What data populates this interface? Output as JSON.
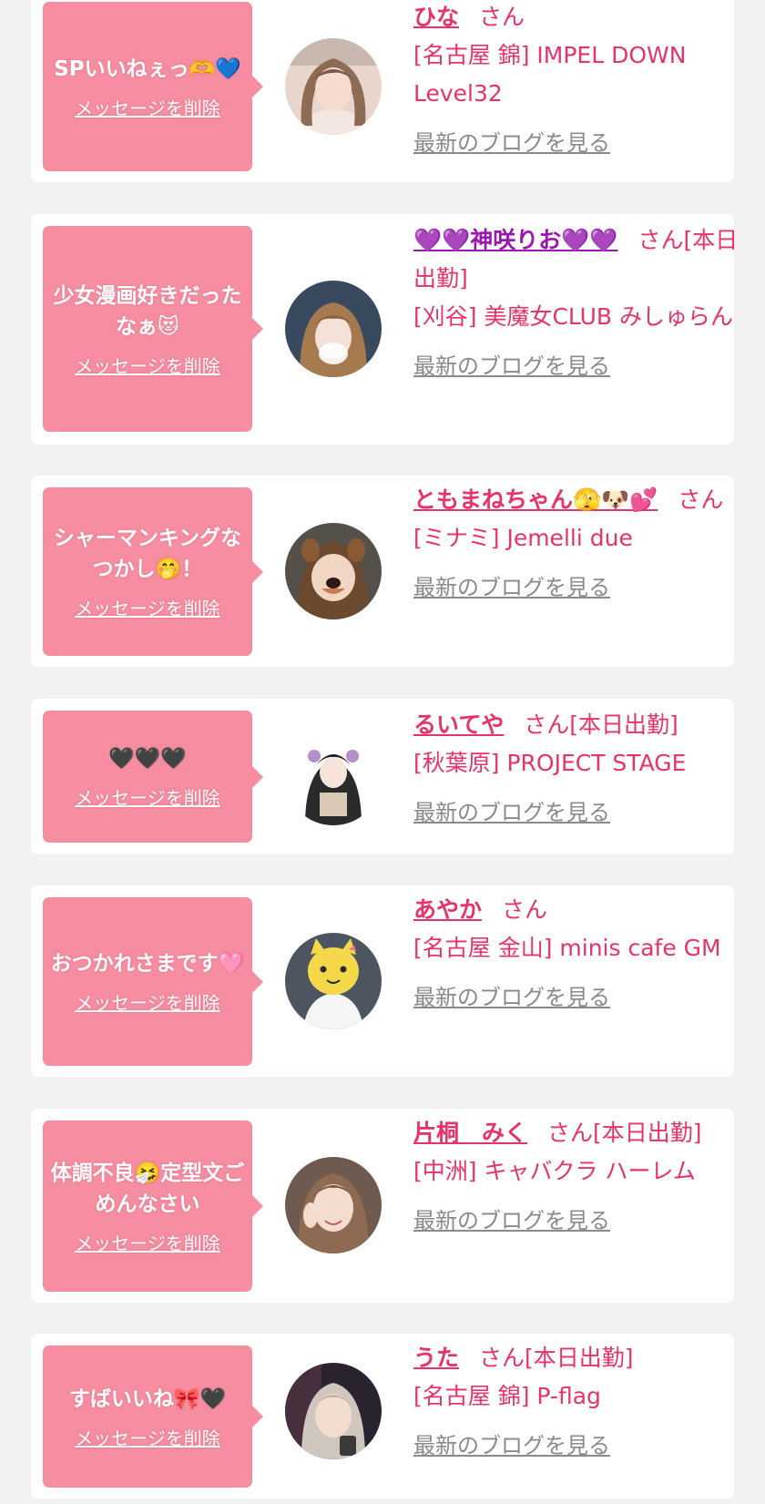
{
  "colors": {
    "page_background": "#f2f2f2",
    "card_background": "#ffffff",
    "bubble_background": "#f78da0",
    "name_text": "#e8336a",
    "name_text_alt": "#9c16b4",
    "blog_link": "#8a8a8a"
  },
  "items": [
    {
      "message": "SPいいねぇっ🫶💙",
      "delete_label": "メッセージを削除",
      "name": "ひな",
      "suffix": "さん",
      "area": "[名古屋 錦] IMPEL DOWN Level32",
      "blog_link": "最新のブログを見る"
    },
    {
      "message": "少女漫画好きだったなぁ😻",
      "delete_label": "メッセージを削除",
      "name": "💜💜神咲りお💜💜",
      "suffix": "さん[本日出勤]",
      "area": "[刈谷] 美魔女CLUB みしゅらん",
      "blog_link": "最新のブログを見る"
    },
    {
      "message": "シャーマンキングなつかし🤭！",
      "delete_label": "メッセージを削除",
      "name": "ともまねちゃん🫣🐶💕",
      "suffix": "さん",
      "area": "[ミナミ] Jemelli due",
      "blog_link": "最新のブログを見る"
    },
    {
      "message": "🖤🖤🖤",
      "delete_label": "メッセージを削除",
      "name": "るいてや",
      "suffix": "さん[本日出勤]",
      "area": "[秋葉原] PROJECT STAGE",
      "blog_link": "最新のブログを見る"
    },
    {
      "message": "おつかれさまです🩷",
      "delete_label": "メッセージを削除",
      "name": "あやか",
      "suffix": "さん",
      "area": "[名古屋 金山] minis cafe GM",
      "blog_link": "最新のブログを見る"
    },
    {
      "message": "体調不良🤧定型文ごめんなさい",
      "delete_label": "メッセージを削除",
      "name": "片桐　みく",
      "suffix": "さん[本日出勤]",
      "area": "[中洲] キャバクラ ハーレム",
      "blog_link": "最新のブログを見る"
    },
    {
      "message": "すばいいね🎀🖤",
      "delete_label": "メッセージを削除",
      "name": "うた",
      "suffix": "さん[本日出勤]",
      "area": "[名古屋 錦] P-flag",
      "blog_link": "最新のブログを見る"
    }
  ]
}
